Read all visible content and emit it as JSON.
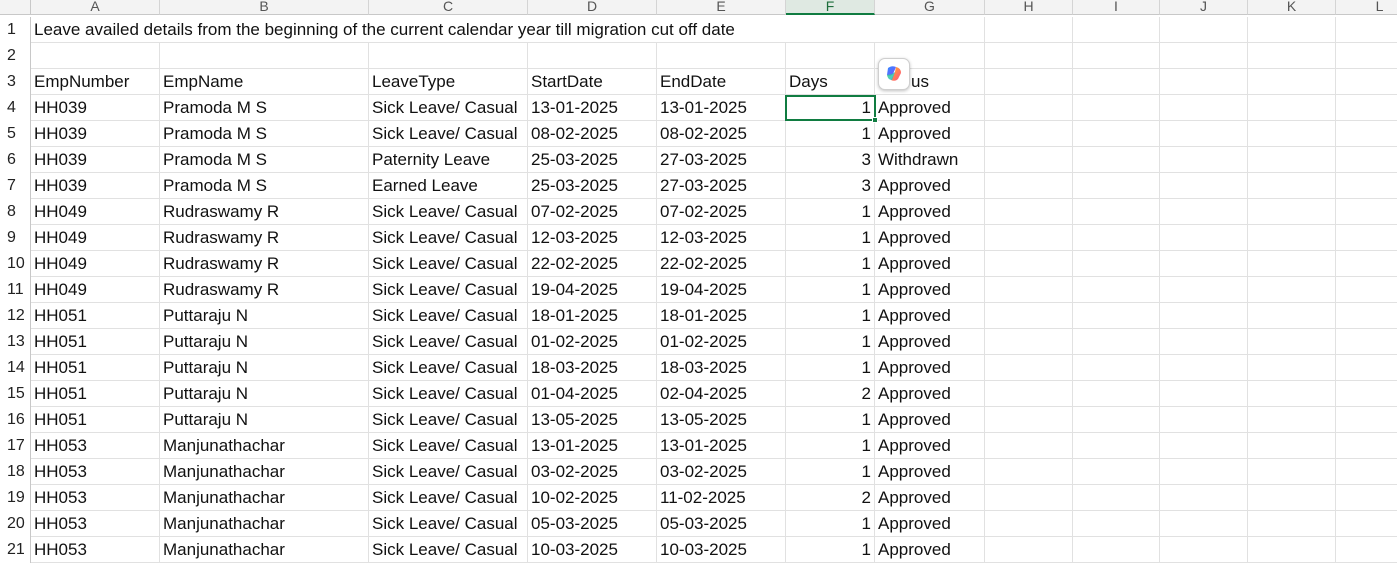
{
  "sheet": {
    "columns": [
      "A",
      "B",
      "C",
      "D",
      "E",
      "F",
      "G",
      "H",
      "I",
      "J",
      "K",
      "L"
    ],
    "selected_column": "F",
    "title_row": {
      "row": "1",
      "text": "Leave availed details from the beginning of the current calendar year till migration cut off date"
    },
    "blank_row": "2",
    "header_row": {
      "row": "3",
      "cells": [
        "EmpNumber",
        "EmpName",
        "LeaveType",
        "StartDate",
        "EndDate",
        "Days",
        "us"
      ]
    },
    "rows": [
      {
        "row": "4",
        "cells": [
          "HH039",
          "Pramoda M S",
          "Sick Leave/ Casual",
          "13-01-2025",
          "13-01-2025",
          "1",
          "Approved"
        ]
      },
      {
        "row": "5",
        "cells": [
          "HH039",
          "Pramoda M S",
          "Sick Leave/ Casual",
          "08-02-2025",
          "08-02-2025",
          "1",
          "Approved"
        ]
      },
      {
        "row": "6",
        "cells": [
          "HH039",
          "Pramoda M S",
          "Paternity Leave",
          "25-03-2025",
          "27-03-2025",
          "3",
          "Withdrawn"
        ]
      },
      {
        "row": "7",
        "cells": [
          "HH039",
          "Pramoda M S",
          "Earned Leave",
          "25-03-2025",
          "27-03-2025",
          "3",
          "Approved"
        ]
      },
      {
        "row": "8",
        "cells": [
          "HH049",
          "Rudraswamy R",
          "Sick Leave/ Casual",
          "07-02-2025",
          "07-02-2025",
          "1",
          "Approved"
        ]
      },
      {
        "row": "9",
        "cells": [
          "HH049",
          "Rudraswamy R",
          "Sick Leave/ Casual",
          "12-03-2025",
          "12-03-2025",
          "1",
          "Approved"
        ]
      },
      {
        "row": "10",
        "cells": [
          "HH049",
          "Rudraswamy R",
          "Sick Leave/ Casual",
          "22-02-2025",
          "22-02-2025",
          "1",
          "Approved"
        ]
      },
      {
        "row": "11",
        "cells": [
          "HH049",
          "Rudraswamy R",
          "Sick Leave/ Casual",
          "19-04-2025",
          "19-04-2025",
          "1",
          "Approved"
        ]
      },
      {
        "row": "12",
        "cells": [
          "HH051",
          "Puttaraju N",
          "Sick Leave/ Casual",
          "18-01-2025",
          "18-01-2025",
          "1",
          "Approved"
        ]
      },
      {
        "row": "13",
        "cells": [
          "HH051",
          "Puttaraju N",
          "Sick Leave/ Casual",
          "01-02-2025",
          "01-02-2025",
          "1",
          "Approved"
        ]
      },
      {
        "row": "14",
        "cells": [
          "HH051",
          "Puttaraju N",
          "Sick Leave/ Casual",
          "18-03-2025",
          "18-03-2025",
          "1",
          "Approved"
        ]
      },
      {
        "row": "15",
        "cells": [
          "HH051",
          "Puttaraju N",
          "Sick Leave/ Casual",
          "01-04-2025",
          "02-04-2025",
          "2",
          "Approved"
        ]
      },
      {
        "row": "16",
        "cells": [
          "HH051",
          "Puttaraju N",
          "Sick Leave/ Casual",
          "13-05-2025",
          "13-05-2025",
          "1",
          "Approved"
        ]
      },
      {
        "row": "17",
        "cells": [
          "HH053",
          "Manjunathachar",
          "Sick Leave/ Casual",
          "13-01-2025",
          "13-01-2025",
          "1",
          "Approved"
        ]
      },
      {
        "row": "18",
        "cells": [
          "HH053",
          "Manjunathachar",
          "Sick Leave/ Casual",
          "03-02-2025",
          "03-02-2025",
          "1",
          "Approved"
        ]
      },
      {
        "row": "19",
        "cells": [
          "HH053",
          "Manjunathachar",
          "Sick Leave/ Casual",
          "10-02-2025",
          "11-02-2025",
          "2",
          "Approved"
        ]
      },
      {
        "row": "20",
        "cells": [
          "HH053",
          "Manjunathachar",
          "Sick Leave/ Casual",
          "05-03-2025",
          "05-03-2025",
          "1",
          "Approved"
        ]
      },
      {
        "row": "21",
        "cells": [
          "HH053",
          "Manjunathachar",
          "Sick Leave/ Casual",
          "10-03-2025",
          "10-03-2025",
          "1",
          "Approved"
        ]
      }
    ],
    "active_cell": "F4",
    "copilot_icon": "copilot-icon",
    "colors": {
      "accent": "#107c41",
      "grid": "#e1e1e1",
      "header_bg": "#f3f3f3"
    }
  }
}
